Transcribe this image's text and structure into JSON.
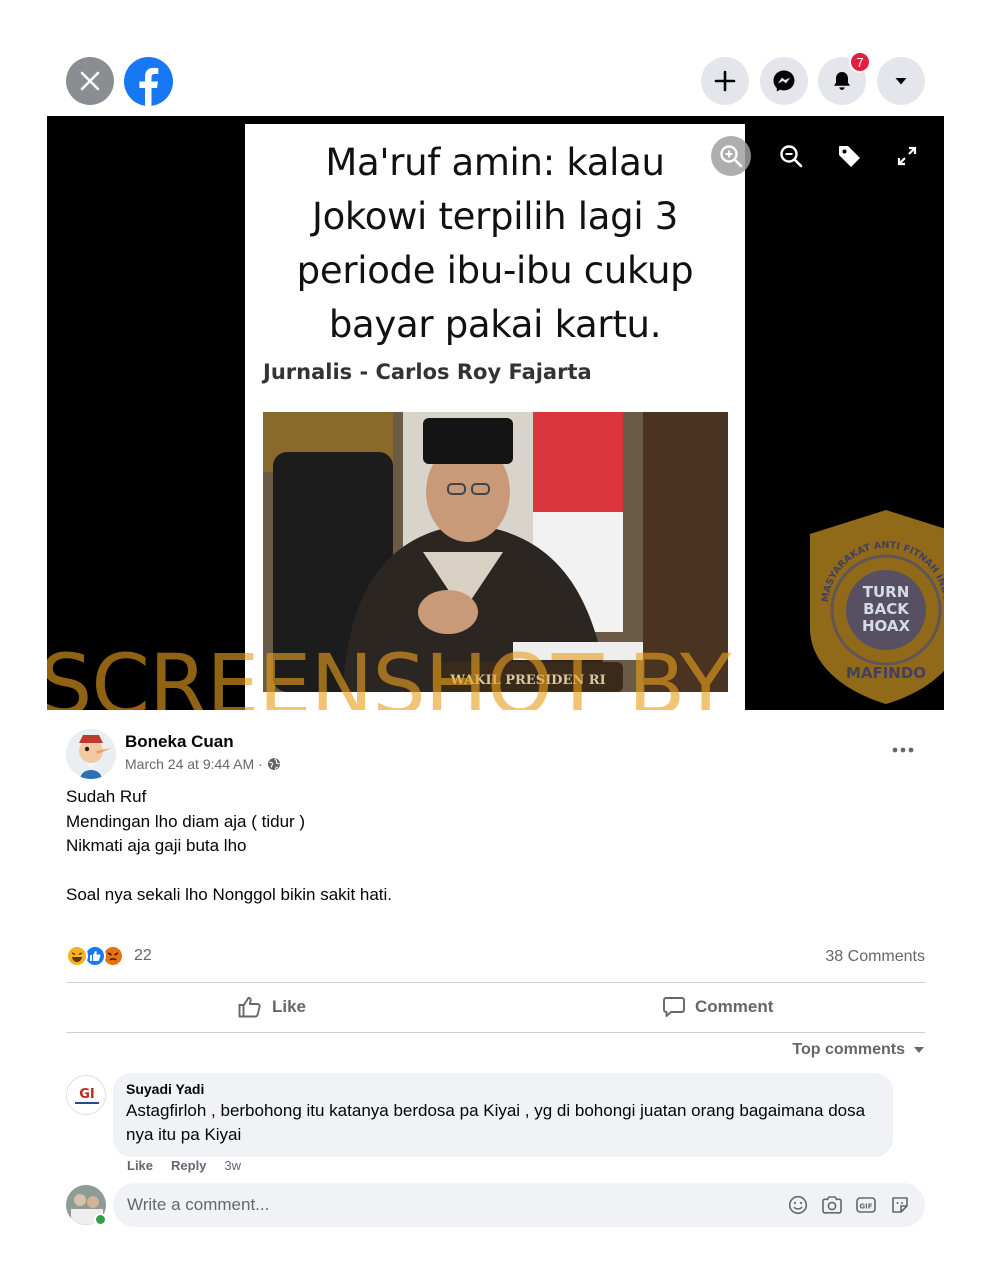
{
  "topbar": {
    "notification_count": "7",
    "icons": [
      "close-icon",
      "facebook-logo",
      "plus-icon",
      "messenger-icon",
      "bell-icon",
      "caret-down-icon"
    ]
  },
  "photo": {
    "headline_lines": [
      "Ma'ruf amin: kalau",
      "Jokowi terpilih lagi 3",
      "periode ibu-ibu cukup",
      "bayar pakai kartu."
    ],
    "byline": "Jurnalis - Carlos Roy Fajarta",
    "nameplate": "WAKIL PRESIDEN RI",
    "tools": [
      "zoom-in-icon",
      "zoom-out-icon",
      "tag-icon",
      "fullscreen-icon"
    ]
  },
  "watermark": {
    "text": "SCREENSHOT BY",
    "seal_ring": "MASYARAKAT ANTI FITNAH INDONESIA",
    "seal_center": [
      "TURN",
      "BACK",
      "HOAX"
    ],
    "seal_bottom": "MAFINDO",
    "color": "#e8a01e"
  },
  "post": {
    "author": "Boneka Cuan",
    "time": "March 24 at 9:44 AM ·",
    "lines": [
      "Sudah Ruf",
      "Mendingan lho diam aja ( tidur )",
      "Nikmati aja gaji buta lho",
      "",
      "Soal nya sekali lho Nonggol bikin sakit hati."
    ],
    "reaction_count": "22",
    "comment_count": "38 Comments",
    "like_label": "Like",
    "comment_label": "Comment",
    "top_comments_label": "Top comments"
  },
  "comment": {
    "avatar_text": "GI",
    "name": "Suyadi Yadi",
    "text": "Astagfirloh , berbohong itu katanya berdosa pa Kiyai , yg di bohongi juatan orang bagaimana dosa nya itu pa Kiyai",
    "like": "Like",
    "reply": "Reply",
    "age": "3w"
  },
  "composer": {
    "placeholder": "Write a comment..."
  },
  "colors": {
    "facebook_blue": "#1877f2",
    "badge_red": "#e41e3f",
    "secondary_text": "#65676b",
    "bubble_bg": "#f0f2f5"
  }
}
